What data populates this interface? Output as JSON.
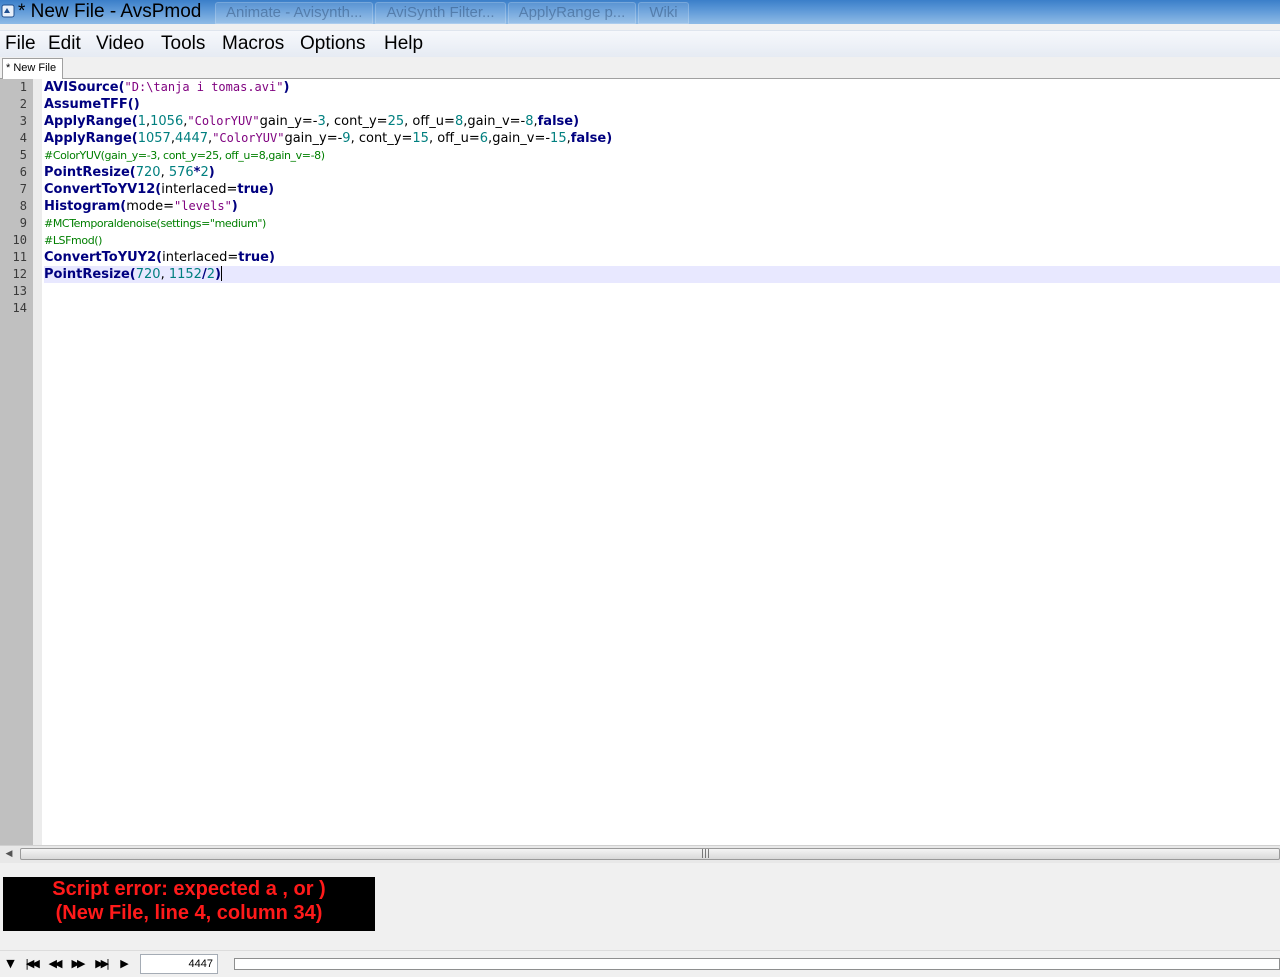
{
  "window": {
    "title": "* New File - AvsPmod",
    "background_tabs": [
      "Animate - Avisynth...",
      "AviSynth Filter...",
      "ApplyRange p...",
      "Wiki"
    ]
  },
  "menu": {
    "items": [
      "File",
      "Edit",
      "Video",
      "Tools",
      "Macros",
      "Options",
      "Help"
    ]
  },
  "tabs": {
    "active_label": "* New File"
  },
  "editor": {
    "line_numbers": [
      "1",
      "2",
      "3",
      "4",
      "5",
      "6",
      "7",
      "8",
      "9",
      "10",
      "11",
      "12",
      "13",
      "14"
    ],
    "current_line": 12,
    "lines": [
      "AVISource(\"D:\\tanja i tomas.avi\")",
      "AssumeTFF()",
      "ApplyRange(1,1056,\"ColorYUV\"gain_y=-3, cont_y=25, off_u=8,gain_v=-8,false)",
      "ApplyRange(1057,4447,\"ColorYUV\"gain_y=-9, cont_y=15, off_u=6,gain_v=-15,false)",
      "#ColorYUV(gain_y=-3, cont_y=25, off_u=8,gain_v=-8)",
      "PointResize(720, 576*2)",
      "ConvertToYV12(interlaced=true)",
      "Histogram(mode=\"levels\")",
      "#MCTemporaldenoise(settings=\"medium\")",
      "#LSFmod()",
      "ConvertToYUY2(interlaced=true)",
      "PointResize(720, 1152/2)",
      "",
      ""
    ],
    "syntax_colors": {
      "keyword": "#00007f",
      "string": "#7f007f",
      "number": "#007f7f",
      "comment": "#007f00"
    }
  },
  "error": {
    "line1": "Script error: expected a , or )",
    "line2": "(New File, line 4, column 34)",
    "color": "#ff1a1a"
  },
  "playback": {
    "frame_value": "4447",
    "buttons": [
      "play-menu-icon",
      "skip-to-start-icon",
      "step-back-icon",
      "step-forward-icon",
      "skip-to-end-icon",
      "play-icon"
    ]
  }
}
